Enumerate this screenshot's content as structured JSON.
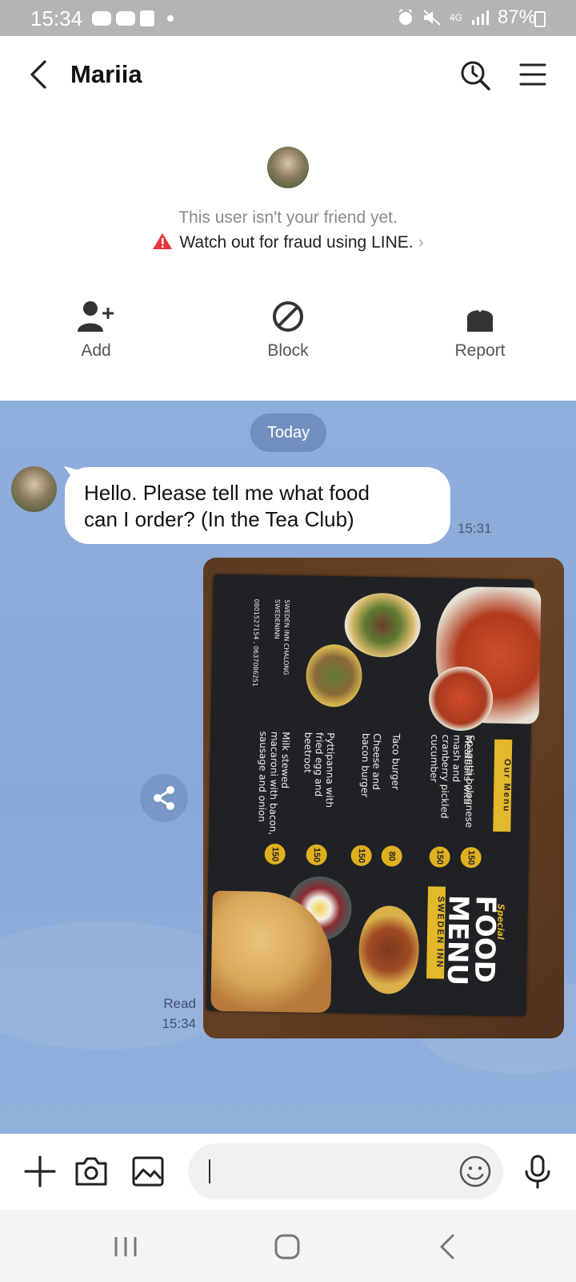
{
  "status_bar": {
    "time": "15:34",
    "network": "4G",
    "battery": "87%",
    "left_icons": [
      "line-notification-icon",
      "youtube-icon",
      "shopping-icon",
      "dot-icon"
    ],
    "right_icons": [
      "alarm-icon",
      "mute-icon",
      "4g-icon",
      "signal-icon",
      "battery-charging-icon"
    ]
  },
  "header": {
    "title": "Mariia",
    "back_icon": "chevron-left-icon",
    "actions": [
      "history-search-icon",
      "hamburger-menu-icon"
    ]
  },
  "friend_notice": {
    "line1": "This user isn't your friend yet.",
    "line2": "Watch out for fraud using LINE.",
    "actions": [
      {
        "label": "Add",
        "icon": "add-friend-icon"
      },
      {
        "label": "Block",
        "icon": "block-icon"
      },
      {
        "label": "Report",
        "icon": "report-icon"
      }
    ]
  },
  "chat": {
    "date_label": "Today",
    "messages": [
      {
        "sender": "Mariia",
        "text_line1": "Hello. Please tell me what food",
        "text_line2": "can I order? (In the Tea Club)",
        "time": "15:31"
      },
      {
        "sender": "me",
        "type": "photo",
        "status": "Read",
        "time": "15:34",
        "photo_text": {
          "special": "Special",
          "title1": "FOOD",
          "title2": "MENU",
          "venue": "SWEDEN INN",
          "our_menu": "Our Menu",
          "items": [
            {
              "name": "Spagetti bolognese",
              "price": "150"
            },
            {
              "name": "Meatballs with mash and cranberry pickled cucumber",
              "price": "150"
            },
            {
              "name": "Taco burger",
              "price": "80"
            },
            {
              "name": "Cheese and bacon burger",
              "price": "150"
            },
            {
              "name": "Pyttipanna with fried egg and beetroot",
              "price": "150"
            },
            {
              "name": "Milk stewed macaroni with bacon, sausage and onion",
              "price": "150"
            }
          ],
          "footer_name": "SWEDEN INN CHALONG",
          "footer_handle": "SWEDENINN",
          "footer_phone": "0801527154 , 0637086251"
        }
      }
    ]
  },
  "input_bar": {
    "icons": [
      "plus-icon",
      "camera-icon",
      "gallery-icon",
      "emoji-icon",
      "microphone-icon"
    ],
    "value": ""
  },
  "colors": {
    "chat_background": "#8eaedb",
    "warning_red": "#e8343f",
    "menu_gold": "#e3b82a"
  }
}
